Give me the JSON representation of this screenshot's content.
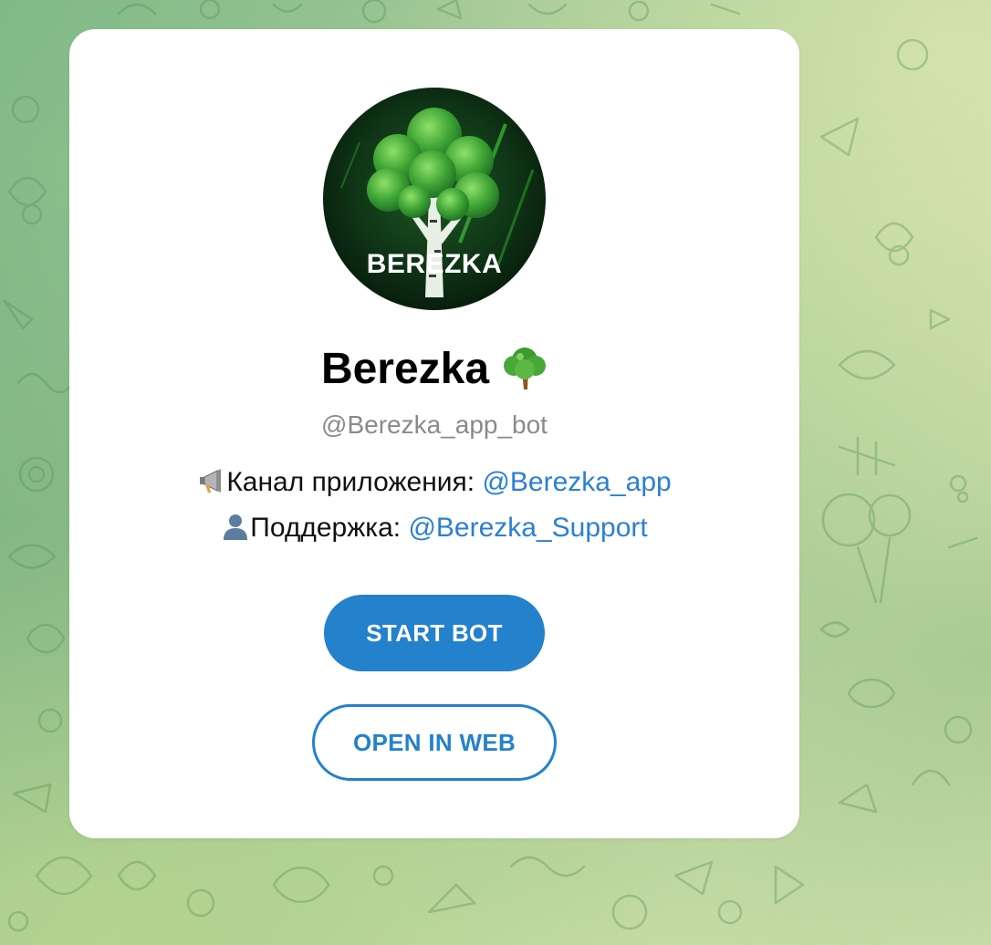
{
  "bot": {
    "avatar_text": "BEREZKA",
    "name": "Berezka",
    "name_emoji_icon": "deciduous-tree-icon",
    "username": "@Berezka_app_bot"
  },
  "description": {
    "channel": {
      "icon": "megaphone-icon",
      "label": "Канал приложения: ",
      "link_text": "@Berezka_app"
    },
    "support": {
      "icon": "person-silhouette-icon",
      "label": "Поддержка: ",
      "link_text": "@Berezka_Support"
    }
  },
  "actions": {
    "start_label": "START BOT",
    "open_web_label": "OPEN IN WEB"
  },
  "colors": {
    "accent": "#2481cc",
    "link": "#2b7fd4",
    "card": "#ffffff",
    "avatar_bg": "#0c2a14",
    "tree_green": "#3fa535"
  }
}
